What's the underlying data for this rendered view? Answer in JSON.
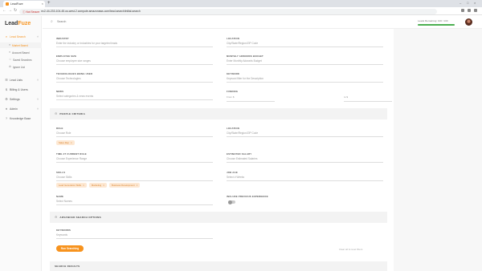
{
  "browser": {
    "tab_title": "LeadFuze",
    "tab_close": "×",
    "new_tab": "+",
    "secure_label": "ⓘ Not Secure",
    "url": "ec2-44-233-104-45.us-west-2.compute.amazonaws.com/lead-search/initial-search",
    "back": "←",
    "forward": "→",
    "reload": "↻",
    "min": "–",
    "max": "□",
    "close": "×"
  },
  "brand": {
    "name_main": "Lead",
    "name_accent": "Fuze"
  },
  "sidebar": {
    "items": [
      {
        "label": "Lead Search",
        "icon": "⌕",
        "active": true,
        "chevron": "˄"
      },
      {
        "label": "Lead Lists",
        "icon": "☰",
        "chevron": "˅"
      },
      {
        "label": "Billing & Users",
        "icon": "$",
        "chevron": ""
      },
      {
        "label": "Settings",
        "icon": "⚙",
        "chevron": "˅"
      },
      {
        "label": "Admin",
        "icon": "♦",
        "chevron": "˅"
      },
      {
        "label": "Knowledge Base",
        "icon": "?",
        "chevron": ""
      }
    ],
    "subitems": [
      {
        "label": "Market Based",
        "icon": "≡"
      },
      {
        "label": "Account Based",
        "icon": "≡"
      },
      {
        "label": "Saved Searches",
        "icon": "☆"
      },
      {
        "label": "Ignore List",
        "icon": "⊘"
      }
    ]
  },
  "top": {
    "search_placeholder": "Search",
    "search_icon": "⌕"
  },
  "right_panel": {
    "label": "Leads Remaining: 100 / 100"
  },
  "company_criteria": {
    "fields": [
      {
        "label": "INDUSTRY",
        "value": "Enter the industry or industries for your targeted leads"
      },
      {
        "label": "LOCATION",
        "value": "City/State/Region/ZIP Code"
      },
      {
        "label": "EMPLOYEE SIZE",
        "value": "Choose employee size ranges"
      },
      {
        "label": "MONTHLY ADWORDS BUDGET",
        "value": "Enter Monthly Adwords Budget"
      },
      {
        "label": "TECHNOLOGIES BEING USED",
        "value": "Choose Technologies"
      },
      {
        "label": "KEYWORD",
        "value": "Keyword filter for the Description"
      },
      {
        "label": "NEWS",
        "value": "Select categories & news events"
      },
      {
        "label": "FUNDING",
        "value": ""
      }
    ],
    "funding_from": "From $",
    "funding_to": "to $"
  },
  "people_criteria": {
    "title": "PEOPLE CRITERIA",
    "fields": [
      {
        "label": "ROLE",
        "value": "Choose Role"
      },
      {
        "label": "LOCATION",
        "value": "City/State/Region/ZIP Code"
      },
      {
        "label": "TIME AT CURRENT ROLE",
        "value": "Choose Experience Range"
      },
      {
        "label": "ESTIMATED SALARY",
        "value": "Choose Estimated Salaries"
      },
      {
        "label": "SKILLS",
        "value": "Choose Skills"
      },
      {
        "label": "JOB AGE",
        "value": "Select # Weeks"
      },
      {
        "label": "NAME",
        "value": "Select Names"
      },
      {
        "label": "INCLUDE PREVIOUS EXPERIENCE",
        "value": ""
      }
    ],
    "role_chips": [
      "Sales Rep"
    ],
    "skill_chips": [
      "Lead Generation Skills",
      "Marketing",
      "Business Development"
    ]
  },
  "advanced": {
    "title": "ADVANCED SEARCH OPTIONS",
    "keywords_label": "KEYWORDS",
    "keywords_value": "Keywords"
  },
  "actions": {
    "run_button": "Run Searching",
    "clear_link": "Clear all & reset filters"
  },
  "saved_results": {
    "title": "SEARCH RESULTS"
  },
  "colors": {
    "accent": "#f7931e",
    "progress": "#4caf50"
  },
  "remaining_fraction": 1.0
}
